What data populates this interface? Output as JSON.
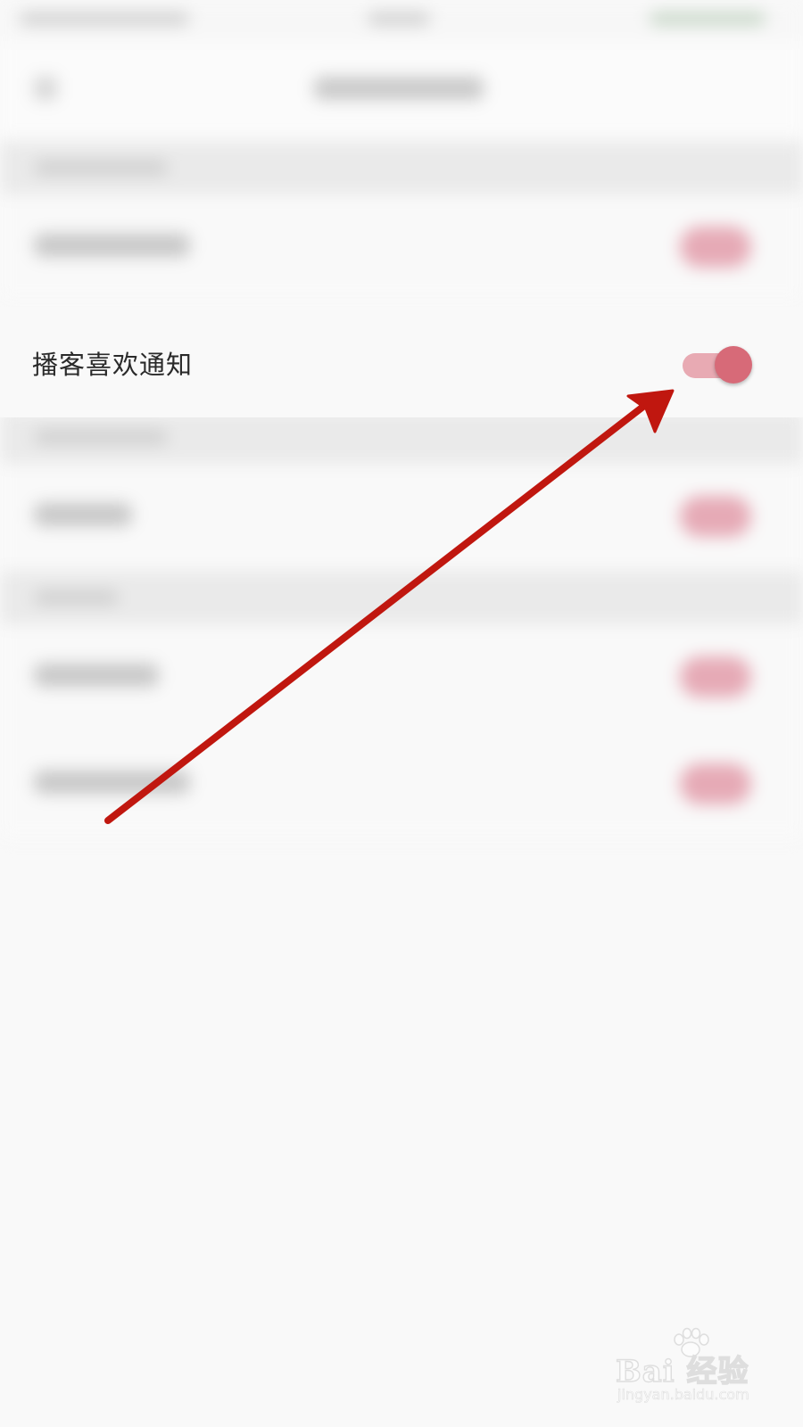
{
  "notification_settings": {
    "podcast_like_notification": {
      "label": "播客喜欢通知",
      "enabled": true
    }
  },
  "colors": {
    "toggle_track_on": "#e8aab3",
    "toggle_knob_on": "#d76a78",
    "annotation_arrow": "#c0170f"
  },
  "watermark": {
    "brand": "Bai  经验",
    "url": "jingyan.baidu.com",
    "icon": "paw-icon"
  }
}
